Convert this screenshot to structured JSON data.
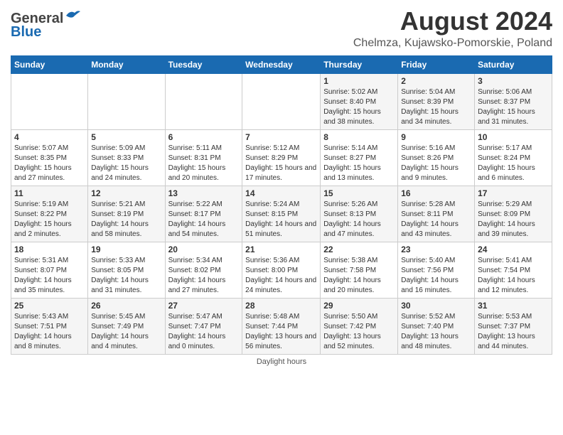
{
  "header": {
    "logo_general": "General",
    "logo_blue": "Blue",
    "title": "August 2024",
    "subtitle": "Chelmza, Kujawsko-Pomorskie, Poland"
  },
  "calendar": {
    "days_of_week": [
      "Sunday",
      "Monday",
      "Tuesday",
      "Wednesday",
      "Thursday",
      "Friday",
      "Saturday"
    ],
    "weeks": [
      [
        {
          "day": "",
          "info": ""
        },
        {
          "day": "",
          "info": ""
        },
        {
          "day": "",
          "info": ""
        },
        {
          "day": "",
          "info": ""
        },
        {
          "day": "1",
          "info": "Sunrise: 5:02 AM\nSunset: 8:40 PM\nDaylight: 15 hours and 38 minutes."
        },
        {
          "day": "2",
          "info": "Sunrise: 5:04 AM\nSunset: 8:39 PM\nDaylight: 15 hours and 34 minutes."
        },
        {
          "day": "3",
          "info": "Sunrise: 5:06 AM\nSunset: 8:37 PM\nDaylight: 15 hours and 31 minutes."
        }
      ],
      [
        {
          "day": "4",
          "info": "Sunrise: 5:07 AM\nSunset: 8:35 PM\nDaylight: 15 hours and 27 minutes."
        },
        {
          "day": "5",
          "info": "Sunrise: 5:09 AM\nSunset: 8:33 PM\nDaylight: 15 hours and 24 minutes."
        },
        {
          "day": "6",
          "info": "Sunrise: 5:11 AM\nSunset: 8:31 PM\nDaylight: 15 hours and 20 minutes."
        },
        {
          "day": "7",
          "info": "Sunrise: 5:12 AM\nSunset: 8:29 PM\nDaylight: 15 hours and 17 minutes."
        },
        {
          "day": "8",
          "info": "Sunrise: 5:14 AM\nSunset: 8:27 PM\nDaylight: 15 hours and 13 minutes."
        },
        {
          "day": "9",
          "info": "Sunrise: 5:16 AM\nSunset: 8:26 PM\nDaylight: 15 hours and 9 minutes."
        },
        {
          "day": "10",
          "info": "Sunrise: 5:17 AM\nSunset: 8:24 PM\nDaylight: 15 hours and 6 minutes."
        }
      ],
      [
        {
          "day": "11",
          "info": "Sunrise: 5:19 AM\nSunset: 8:22 PM\nDaylight: 15 hours and 2 minutes."
        },
        {
          "day": "12",
          "info": "Sunrise: 5:21 AM\nSunset: 8:19 PM\nDaylight: 14 hours and 58 minutes."
        },
        {
          "day": "13",
          "info": "Sunrise: 5:22 AM\nSunset: 8:17 PM\nDaylight: 14 hours and 54 minutes."
        },
        {
          "day": "14",
          "info": "Sunrise: 5:24 AM\nSunset: 8:15 PM\nDaylight: 14 hours and 51 minutes."
        },
        {
          "day": "15",
          "info": "Sunrise: 5:26 AM\nSunset: 8:13 PM\nDaylight: 14 hours and 47 minutes."
        },
        {
          "day": "16",
          "info": "Sunrise: 5:28 AM\nSunset: 8:11 PM\nDaylight: 14 hours and 43 minutes."
        },
        {
          "day": "17",
          "info": "Sunrise: 5:29 AM\nSunset: 8:09 PM\nDaylight: 14 hours and 39 minutes."
        }
      ],
      [
        {
          "day": "18",
          "info": "Sunrise: 5:31 AM\nSunset: 8:07 PM\nDaylight: 14 hours and 35 minutes."
        },
        {
          "day": "19",
          "info": "Sunrise: 5:33 AM\nSunset: 8:05 PM\nDaylight: 14 hours and 31 minutes."
        },
        {
          "day": "20",
          "info": "Sunrise: 5:34 AM\nSunset: 8:02 PM\nDaylight: 14 hours and 27 minutes."
        },
        {
          "day": "21",
          "info": "Sunrise: 5:36 AM\nSunset: 8:00 PM\nDaylight: 14 hours and 24 minutes."
        },
        {
          "day": "22",
          "info": "Sunrise: 5:38 AM\nSunset: 7:58 PM\nDaylight: 14 hours and 20 minutes."
        },
        {
          "day": "23",
          "info": "Sunrise: 5:40 AM\nSunset: 7:56 PM\nDaylight: 14 hours and 16 minutes."
        },
        {
          "day": "24",
          "info": "Sunrise: 5:41 AM\nSunset: 7:54 PM\nDaylight: 14 hours and 12 minutes."
        }
      ],
      [
        {
          "day": "25",
          "info": "Sunrise: 5:43 AM\nSunset: 7:51 PM\nDaylight: 14 hours and 8 minutes."
        },
        {
          "day": "26",
          "info": "Sunrise: 5:45 AM\nSunset: 7:49 PM\nDaylight: 14 hours and 4 minutes."
        },
        {
          "day": "27",
          "info": "Sunrise: 5:47 AM\nSunset: 7:47 PM\nDaylight: 14 hours and 0 minutes."
        },
        {
          "day": "28",
          "info": "Sunrise: 5:48 AM\nSunset: 7:44 PM\nDaylight: 13 hours and 56 minutes."
        },
        {
          "day": "29",
          "info": "Sunrise: 5:50 AM\nSunset: 7:42 PM\nDaylight: 13 hours and 52 minutes."
        },
        {
          "day": "30",
          "info": "Sunrise: 5:52 AM\nSunset: 7:40 PM\nDaylight: 13 hours and 48 minutes."
        },
        {
          "day": "31",
          "info": "Sunrise: 5:53 AM\nSunset: 7:37 PM\nDaylight: 13 hours and 44 minutes."
        }
      ]
    ]
  },
  "footer": {
    "daylight_hours": "Daylight hours"
  }
}
